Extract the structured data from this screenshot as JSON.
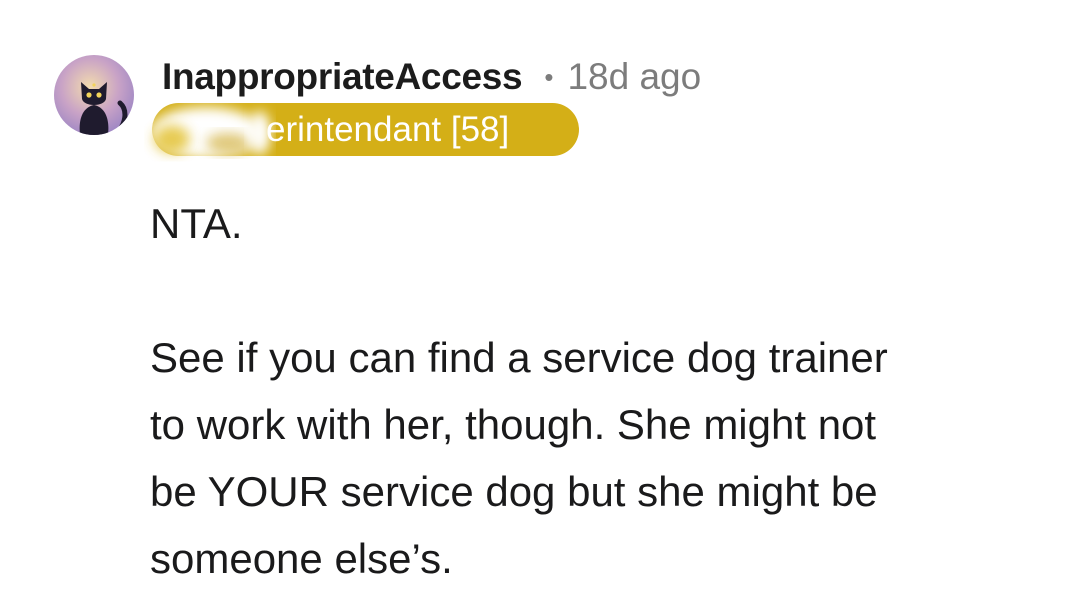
{
  "comment": {
    "author": {
      "username": "InappropriateAccess",
      "avatar_icon": "cat-avatar-icon"
    },
    "separator": "•",
    "timestamp": "18d ago",
    "flair": {
      "text": "erintendant [58]",
      "background_color": "#d4af17",
      "text_color": "#ffffff",
      "redacted": true
    },
    "body": {
      "paragraphs": [
        "NTA.",
        "See if you can find a service dog trainer\nto work with her, though. She might not\nbe YOUR service dog but she might be\nsomeone else’s."
      ]
    }
  },
  "colors": {
    "username": "#1c1c1c",
    "meta": "#7c7c7c",
    "body_text": "#1a1a1b",
    "background": "#ffffff"
  }
}
